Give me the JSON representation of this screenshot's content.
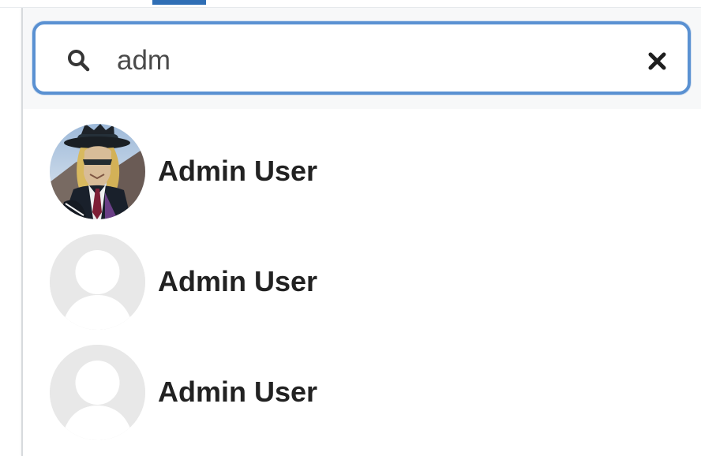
{
  "search": {
    "value": "adm",
    "search_icon": "search-icon",
    "clear_icon": "close-icon"
  },
  "results": [
    {
      "name": "Admin User",
      "avatar": "photo-avatar"
    },
    {
      "name": "Admin User",
      "avatar": "default-avatar"
    },
    {
      "name": "Admin User",
      "avatar": "default-avatar"
    }
  ],
  "colors": {
    "focus_border": "#5a91d2",
    "active_tab": "#2f6eb5",
    "text": "#222222",
    "placeholder_avatar": "#e8e8e8"
  }
}
